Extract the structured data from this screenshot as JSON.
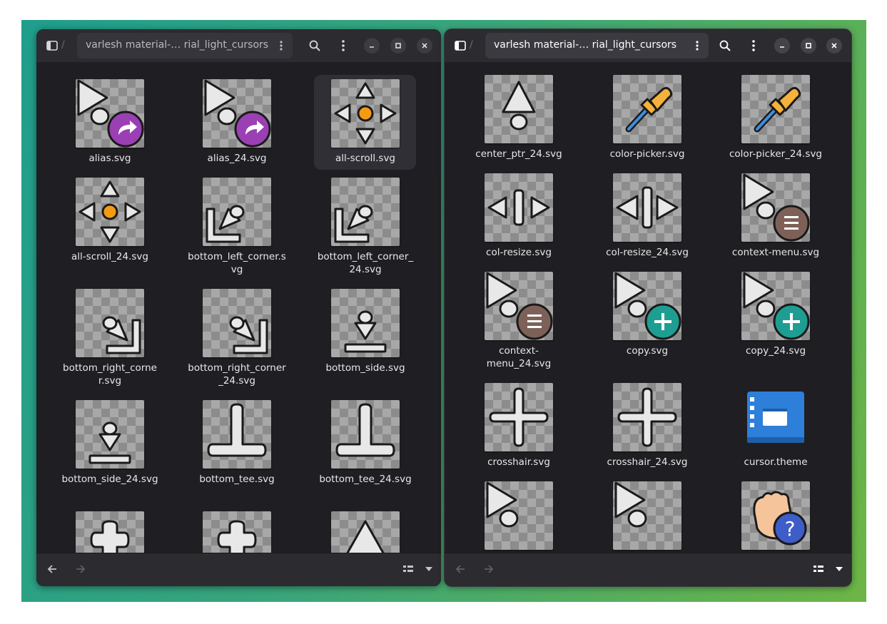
{
  "left_window": {
    "path_label": "varlesh material-… rial_light_cursors",
    "items": [
      {
        "name": "alias.svg"
      },
      {
        "name": "alias_24.svg"
      },
      {
        "name": "all-scroll.svg"
      },
      {
        "name": "all-scroll_24.svg"
      },
      {
        "name": "bottom_left_corner.svg"
      },
      {
        "name": "bottom_left_corner_24.svg"
      },
      {
        "name": "bottom_right_corner.svg"
      },
      {
        "name": "bottom_right_corner_24.svg"
      },
      {
        "name": "bottom_side.svg"
      },
      {
        "name": "bottom_side_24.svg"
      },
      {
        "name": "bottom_tee.svg"
      },
      {
        "name": "bottom_tee_24.svg"
      }
    ]
  },
  "right_window": {
    "path_label": "varlesh material-… rial_light_cursors",
    "items": [
      {
        "name": "center_ptr_24.svg"
      },
      {
        "name": "color-picker.svg"
      },
      {
        "name": "color-picker_24.svg"
      },
      {
        "name": "col-resize.svg"
      },
      {
        "name": "col-resize_24.svg"
      },
      {
        "name": "context-menu.svg"
      },
      {
        "name": "context-menu_24.svg"
      },
      {
        "name": "copy.svg"
      },
      {
        "name": "copy_24.svg"
      },
      {
        "name": "crosshair.svg"
      },
      {
        "name": "crosshair_24.svg"
      },
      {
        "name": "cursor.theme"
      }
    ]
  },
  "colors": {
    "desktop_start": "#1f9e8c",
    "desktop_end": "#6db545",
    "window_bg": "#1f1f23",
    "headerbar": "#2b2b30",
    "alias_badge": "#9b3fb5",
    "copy_badge": "#1e9e93",
    "menu_badge": "#7d6158",
    "scroll_dot": "#f59b12",
    "picker": "#f5b13a",
    "folder_blue": "#2e7fd9",
    "help_badge": "#3e5dc9"
  }
}
